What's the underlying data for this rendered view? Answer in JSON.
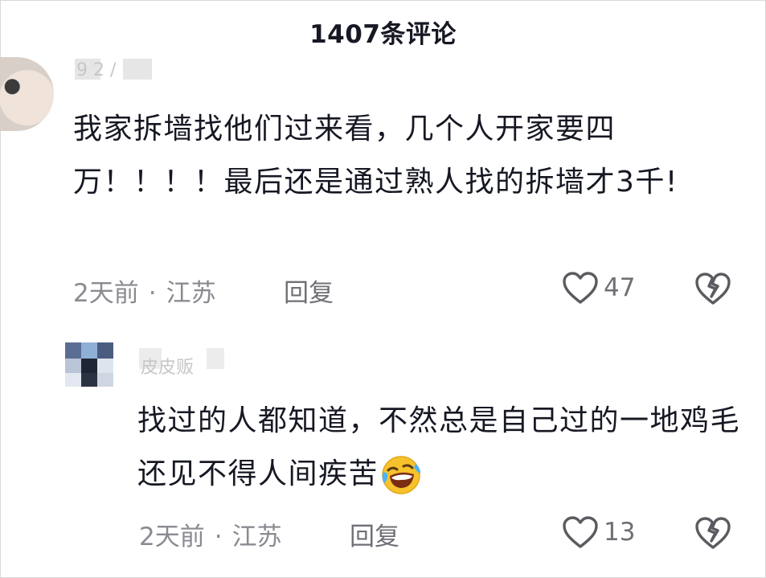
{
  "header": {
    "title": "1407条评论"
  },
  "comments": [
    {
      "username": "9 2 /",
      "content": "我家拆墙找他们过来看，几个人开家要四万！！！！最后还是通过熟人找的拆墙才3千!",
      "time": "2天前",
      "location": "江苏",
      "reply_label": "回复",
      "likes": "47"
    }
  ],
  "reply": {
    "username": "皮皮贩",
    "content": "找过的人都知道，不然总是自己过的一地鸡毛还见不得人间疾苦",
    "emoji": "laughing-crying-emoji",
    "time": "2天前",
    "location": "江苏",
    "reply_label": "回复",
    "likes": "13"
  },
  "colors": {
    "text_primary": "#161823",
    "text_meta": "#8a8b91",
    "icon": "#5a5b60"
  }
}
